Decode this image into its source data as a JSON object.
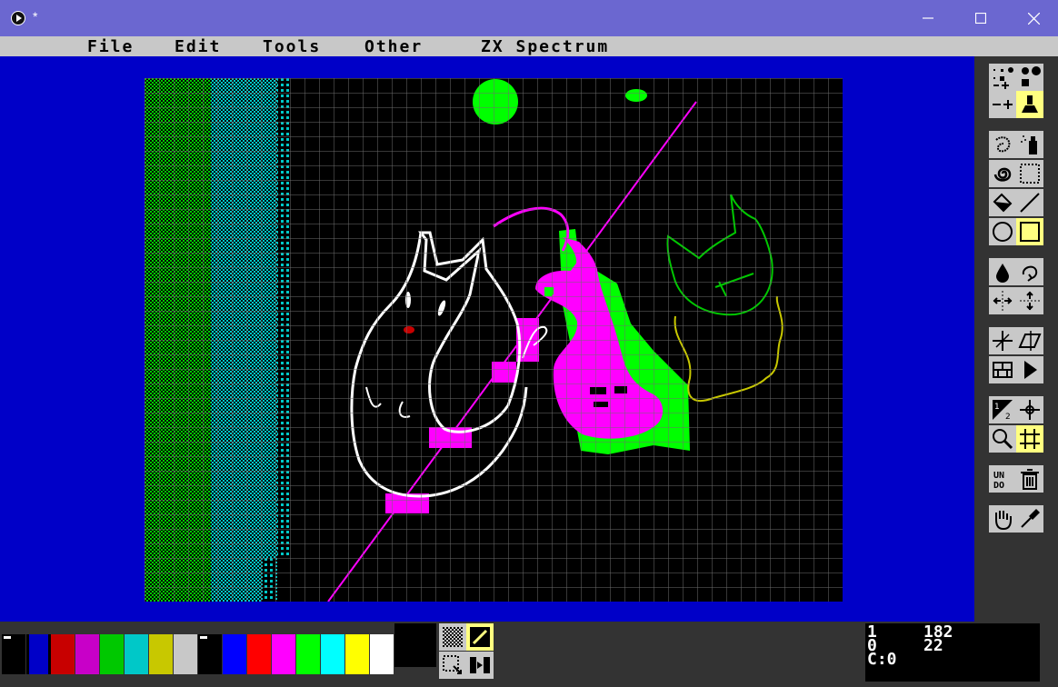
{
  "window": {
    "title": "*"
  },
  "menu": {
    "items": [
      {
        "label": "File"
      },
      {
        "label": "Edit"
      },
      {
        "label": "Tools"
      },
      {
        "label": "Other"
      },
      {
        "label": "ZX Spectrum"
      }
    ]
  },
  "tools": [
    {
      "name": "brush-size-tool",
      "icon": "brush-sizes-icon",
      "active": false
    },
    {
      "name": "brush-shape-tool",
      "icon": "brush-stamp-icon",
      "active": true
    },
    {
      "name": "freehand-tool",
      "icon": "freehand-icon",
      "active": false
    },
    {
      "name": "spray-tool",
      "icon": "spray-can-icon",
      "active": false
    },
    {
      "name": "curve-tool",
      "icon": "spiral-icon",
      "active": false
    },
    {
      "name": "select-tool",
      "icon": "dotted-rect-icon",
      "active": false
    },
    {
      "name": "fill-tool",
      "icon": "paint-bucket-icon",
      "active": false
    },
    {
      "name": "line-tool",
      "icon": "line-icon",
      "active": false
    },
    {
      "name": "circle-tool",
      "icon": "circle-icon",
      "active": false
    },
    {
      "name": "rectangle-tool",
      "icon": "rectangle-icon",
      "active": true
    },
    {
      "name": "ink-fill-tool",
      "icon": "ink-drop-icon",
      "active": false
    },
    {
      "name": "rotate-tool",
      "icon": "rotate-arrow-icon",
      "active": false
    },
    {
      "name": "flip-horizontal-tool",
      "icon": "flip-horizontal-icon",
      "active": false
    },
    {
      "name": "flip-vertical-tool",
      "icon": "flip-vertical-icon",
      "active": false
    },
    {
      "name": "mirror-x-tool",
      "icon": "mirror-cross-icon",
      "active": false
    },
    {
      "name": "perspective-tool",
      "icon": "perspective-icon",
      "active": false
    },
    {
      "name": "brick-tool",
      "icon": "brick-pattern-icon",
      "active": false
    },
    {
      "name": "play-tool",
      "icon": "play-icon",
      "active": false
    },
    {
      "name": "half-tool",
      "icon": "half-diagonal-icon",
      "active": false
    },
    {
      "name": "crosshair-tool",
      "icon": "crosshair-icon",
      "active": false
    },
    {
      "name": "zoom-tool",
      "icon": "magnifier-icon",
      "active": false
    },
    {
      "name": "grid-toggle",
      "icon": "grid-icon",
      "active": true
    },
    {
      "name": "undo-tool",
      "icon": "undo-icon",
      "label": "UNDO",
      "active": false
    },
    {
      "name": "clear-tool",
      "icon": "trash-icon",
      "active": false
    },
    {
      "name": "hand-tool",
      "icon": "hand-icon",
      "active": false
    },
    {
      "name": "eyedropper-tool",
      "icon": "eyedropper-icon",
      "active": false
    }
  ],
  "palette": {
    "colors": [
      "#000000",
      "#0000c8",
      "#c80000",
      "#c800c8",
      "#00c800",
      "#00c8c8",
      "#c8c800",
      "#c8c8c8",
      "#000000",
      "#0000ff",
      "#ff0000",
      "#ff00ff",
      "#00ff00",
      "#00ffff",
      "#ffff00",
      "#ffffff"
    ],
    "selected_ink": "#000000"
  },
  "status": {
    "mode": "1",
    "x": "182",
    "flag": "0",
    "y": "22",
    "color_label": "C:0"
  },
  "colors": {
    "screen": "#0000c8",
    "titlebar": "#6b67d0",
    "panel": "#333333",
    "menu": "#c8c8c8",
    "active_tool": "#ffff80"
  }
}
